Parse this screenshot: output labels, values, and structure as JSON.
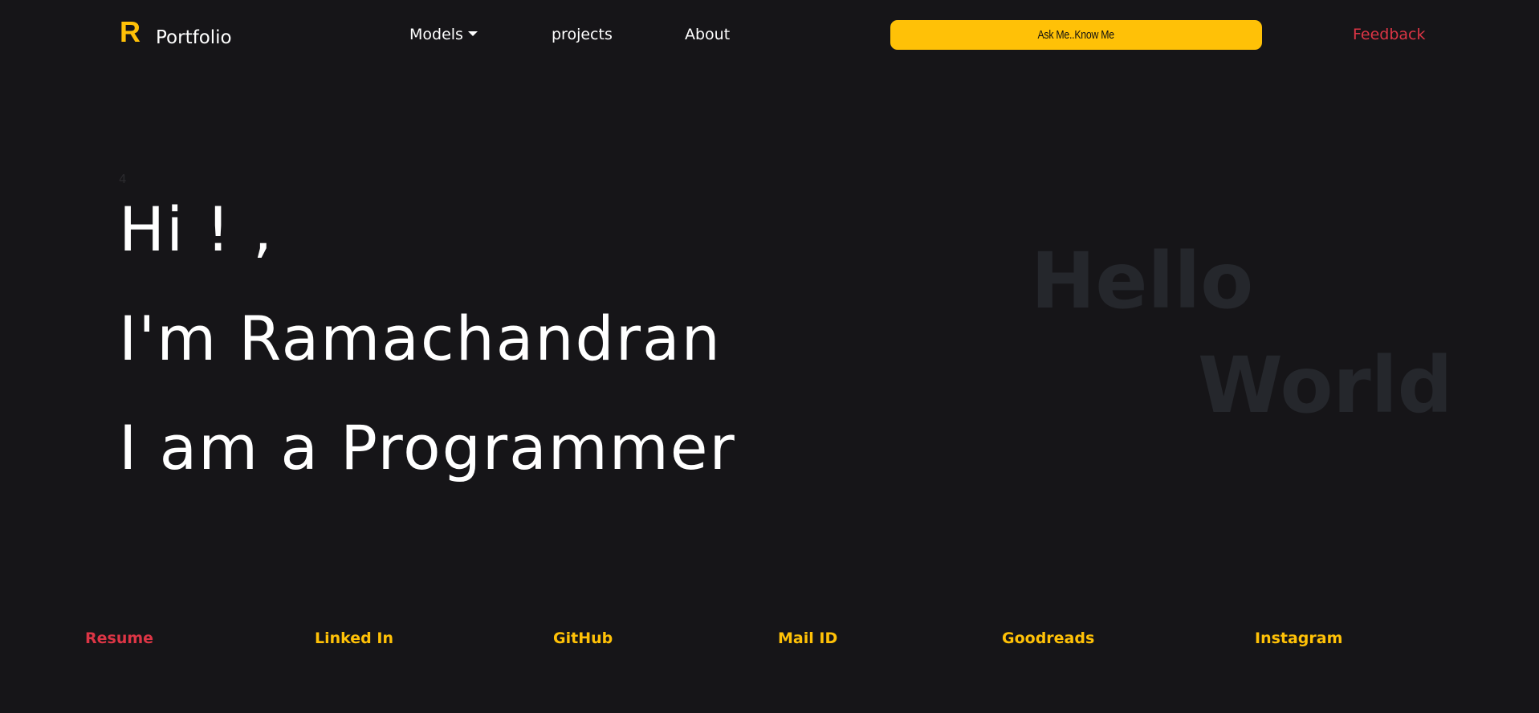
{
  "navbar": {
    "logo": "R",
    "brand": "Portfolio",
    "models_label": "Models",
    "projects_label": "projects",
    "about_label": "About",
    "ask_button_label": "Ask Me..Know Me",
    "feedback_label": "Feedback"
  },
  "hero": {
    "counter": "4",
    "line1": "Hi ! ,",
    "line2": "I'm Ramachandran",
    "line3": "I am a Programmer",
    "bg_word1": "Hello",
    "bg_word2": "World"
  },
  "footer": {
    "links": [
      {
        "label": "Resume"
      },
      {
        "label": "Linked In"
      },
      {
        "label": "GitHub"
      },
      {
        "label": "Mail ID"
      },
      {
        "label": "Goodreads"
      },
      {
        "label": "Instagram"
      }
    ]
  },
  "colors": {
    "background": "#161518",
    "accent": "#ffc107",
    "danger": "#dc3545",
    "bg_text": "#25272c"
  }
}
